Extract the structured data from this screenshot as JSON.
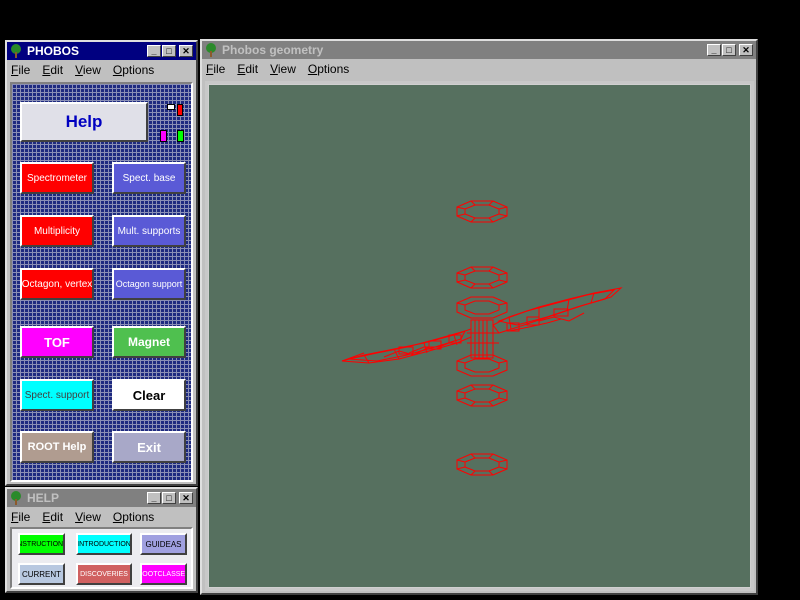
{
  "phobos": {
    "title": "PHOBOS",
    "menu": [
      "File",
      "Edit",
      "View",
      "Options"
    ],
    "help_button": "Help",
    "buttons": {
      "spectrometer": "Spectrometer",
      "spect_base": "Spect. base",
      "multiplicity": "Multiplicity",
      "mult_supports": "Mult. supports",
      "octagon_vertex": "Octagon, vertex",
      "octagon_support": "Octagon support",
      "tof": "TOF",
      "magnet": "Magnet",
      "spect_support": "Spect. support",
      "clear": "Clear",
      "root_help": "ROOT Help",
      "exit": "Exit"
    },
    "colors": {
      "red": "#ff0000",
      "blue": "#5a5ad6",
      "magenta": "#ff00ff",
      "green": "#4fc04f",
      "cyan": "#00ffff",
      "white": "#ffffff",
      "tan": "#b09c90",
      "lavender": "#a8a8c8"
    }
  },
  "geometry": {
    "title": "Phobos geometry",
    "menu": [
      "File",
      "Edit",
      "View",
      "Options"
    ],
    "background": "#56705f",
    "wire_color": "#ff0000"
  },
  "help": {
    "title": "HELP",
    "menu": [
      "File",
      "Edit",
      "View",
      "Options"
    ],
    "buttons": {
      "instructions": "INSTRUCTIONS",
      "introduction": "INTRODUCTION",
      "guideas": "GUIDEAS",
      "current": "CURRENT",
      "discoveries": "DISCOVERIES",
      "rootclasses": "ROOTCLASSES"
    }
  }
}
